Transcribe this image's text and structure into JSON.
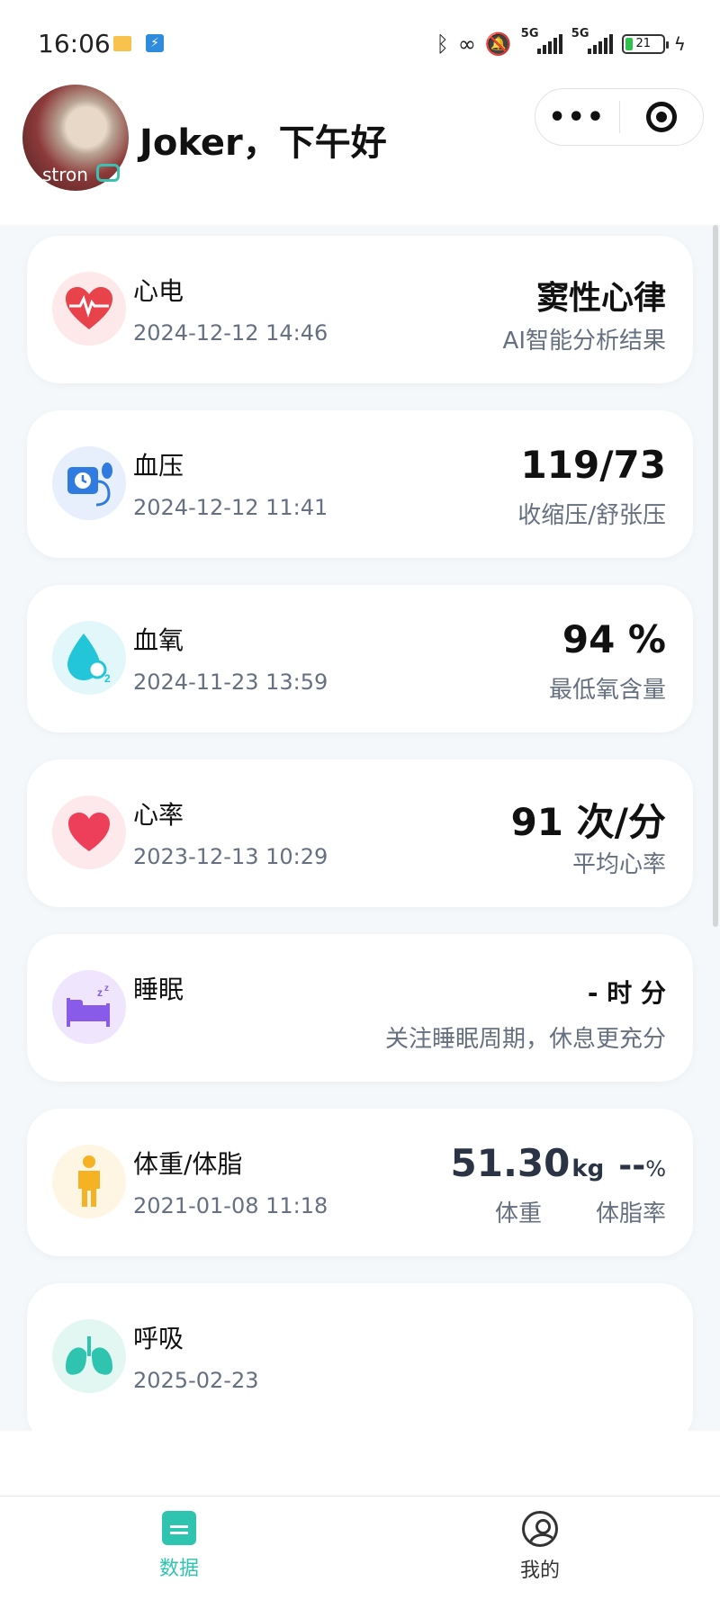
{
  "status_bar": {
    "time": "16:06",
    "battery_level": "21",
    "network_1": "5G",
    "network_2": "5G"
  },
  "header": {
    "greeting": "Joker，下午好",
    "avatar_text": "stron"
  },
  "cards": [
    {
      "title": "心电",
      "date": "2024-12-12 14:46",
      "value": "窦性心律",
      "sub": "AI智能分析结果",
      "icon": "ecg-heart-icon",
      "color": "#e8424a"
    },
    {
      "title": "血压",
      "date": "2024-12-12 11:41",
      "value": "119/73",
      "sub": "收缩压/舒张压",
      "icon": "blood-pressure-icon",
      "color": "#2f7be0"
    },
    {
      "title": "血氧",
      "date": "2024-11-23 13:59",
      "value": "94 %",
      "sub": "最低氧含量",
      "icon": "oxygen-drop-icon",
      "color": "#22c6d8"
    },
    {
      "title": "心率",
      "date": "2023-12-13 10:29",
      "value": "91 次/分",
      "sub": "平均心率",
      "icon": "heart-icon",
      "color": "#ee3f5a"
    },
    {
      "title": "睡眠",
      "date": "",
      "value": "- 时 分",
      "sub": "关注睡眠周期，休息更充分",
      "icon": "sleep-bed-icon",
      "color": "#8a5ae8"
    },
    {
      "title": "体重/体脂",
      "date": "2021-01-08 11:18",
      "weight": "51.30",
      "weight_unit": "kg",
      "fat": "--",
      "fat_unit": "%",
      "weight_label": "体重",
      "fat_label": "体脂率",
      "icon": "body-weight-icon",
      "color": "#f5b324"
    },
    {
      "title": "呼吸",
      "date": "2025-02-23",
      "icon": "lungs-icon",
      "color": "#2ec4b0"
    }
  ],
  "tabs": [
    {
      "label": "数据",
      "icon": "data-tab-icon",
      "active": true
    },
    {
      "label": "我的",
      "icon": "profile-tab-icon",
      "active": false
    }
  ]
}
